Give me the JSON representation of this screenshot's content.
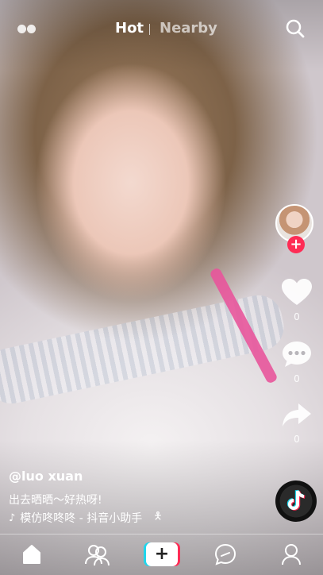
{
  "header": {
    "tabs": [
      {
        "label": "Hot",
        "active": true
      },
      {
        "label": "Nearby",
        "active": false
      }
    ],
    "icons": {
      "left": "live-dots-icon",
      "right": "search-icon"
    }
  },
  "side_actions": {
    "follow_label": "+",
    "likes": "0",
    "comments": "0",
    "shares": "0"
  },
  "post": {
    "username": "@luo  xuan",
    "description": "出去晒晒～好热呀!",
    "music": "模仿咚咚咚 - 抖音小助手"
  },
  "bottom_nav": {
    "items": [
      "home-icon",
      "friends-icon",
      "create-icon",
      "inbox-icon",
      "profile-icon"
    ],
    "create_label": "+"
  },
  "colors": {
    "accent_red": "#fe2c55",
    "accent_cyan": "#20d5ec",
    "text": "#ffffff"
  }
}
